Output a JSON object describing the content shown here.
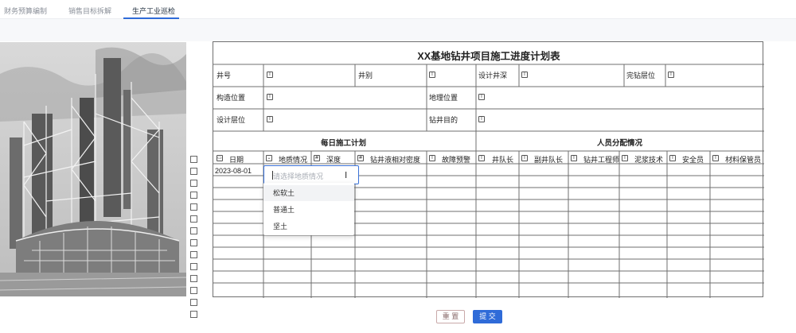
{
  "tabs": [
    {
      "label": "财务预算编制"
    },
    {
      "label": "销售目标拆解"
    },
    {
      "label": "生产工业巡检"
    }
  ],
  "form": {
    "title": "XX基地钻井项目施工进度计划表",
    "fields": {
      "well_no": "井号",
      "well_type": "井别",
      "design_depth": "设计井深",
      "completion_layer": "完钻层位",
      "structure_position": "构造位置",
      "geo_position": "地理位置",
      "design_layer": "设计层位",
      "drilling_purpose": "钻井目的"
    },
    "sections": {
      "daily_plan": "每日施工计划",
      "staffing": "人员分配情况"
    },
    "columns": [
      "日期",
      "地质情况",
      "深度",
      "钻井液相对密度",
      "故障预警",
      "井队长",
      "副井队长",
      "钻井工程师",
      "泥浆技术",
      "安全员",
      "材料保管员"
    ],
    "first_row_date": "2023-08-01",
    "row_count": 13
  },
  "dropdown": {
    "placeholder": "请选择地质情况",
    "options": [
      "松软土",
      "普通土",
      "坚土"
    ]
  },
  "buttons": {
    "reset": "重 置",
    "submit": "提 交"
  },
  "colors": {
    "accent": "#2f6bd8",
    "border": "#6f6f6f"
  }
}
